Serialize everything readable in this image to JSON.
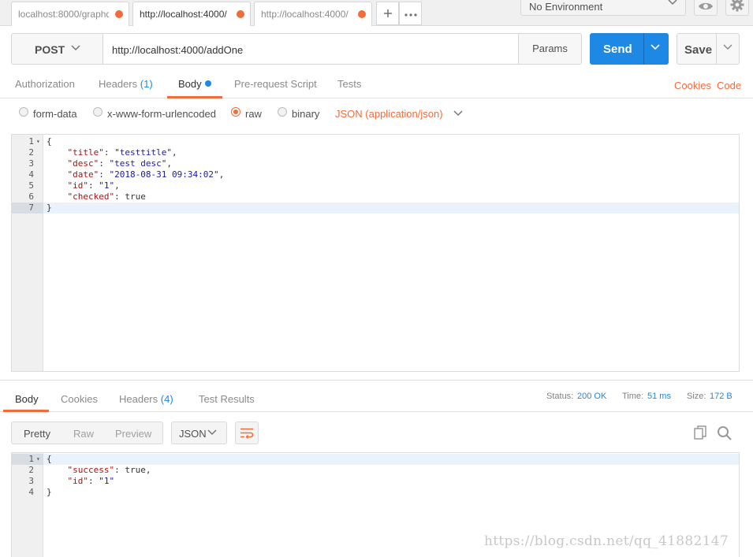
{
  "tabs": [
    {
      "label": "localhost:8000/graphq",
      "active": false
    },
    {
      "label": "http://localhost:4000/",
      "active": true
    },
    {
      "label": "http://localhost:4000/",
      "active": false
    }
  ],
  "tab_actions": {
    "add_icon": "plus-icon",
    "more_icon": "more-icon"
  },
  "environment": {
    "selected": "No Environment",
    "eye_icon": "eye-icon",
    "settings_icon": "gear-icon"
  },
  "request": {
    "method": "POST",
    "url": "http://localhost:4000/addOne",
    "params_label": "Params",
    "send_label": "Send",
    "save_label": "Save"
  },
  "request_tabs": [
    {
      "label": "Authorization"
    },
    {
      "label": "Headers",
      "count": "(1)"
    },
    {
      "label": "Body",
      "active": true
    },
    {
      "label": "Pre-request Script"
    },
    {
      "label": "Tests"
    }
  ],
  "request_links": {
    "cookies": "Cookies",
    "code": "Code"
  },
  "body_types": [
    {
      "label": "form-data",
      "selected": false
    },
    {
      "label": "x-www-form-urlencoded",
      "selected": false
    },
    {
      "label": "raw",
      "selected": true
    },
    {
      "label": "binary",
      "selected": false
    }
  ],
  "raw_type": "JSON (application/json)",
  "request_body": {
    "line_numbers": [
      "1",
      "2",
      "3",
      "4",
      "5",
      "6",
      "7"
    ],
    "open_brace": "{",
    "close_brace": "}",
    "fields": [
      {
        "key": "\"title\"",
        "value": "\"testtitle\"",
        "sep": ","
      },
      {
        "key": "\"desc\"",
        "value": "\"test desc\"",
        "sep": ","
      },
      {
        "key": "\"date\"",
        "value": "\"2018-08-31 09:34:02\"",
        "sep": ","
      },
      {
        "key": "\"id\"",
        "value": "\"1\"",
        "sep": ","
      },
      {
        "key": "\"checked\"",
        "value": "true",
        "sep": ""
      }
    ]
  },
  "response_tabs": [
    {
      "label": "Body",
      "active": true
    },
    {
      "label": "Cookies"
    },
    {
      "label": "Headers",
      "count": "(4)"
    },
    {
      "label": "Test Results"
    }
  ],
  "response_status": {
    "status_label": "Status:",
    "status_value": "200 OK",
    "time_label": "Time:",
    "time_value": "51 ms",
    "size_label": "Size:",
    "size_value": "172 B"
  },
  "response_view": {
    "modes": [
      "Pretty",
      "Raw",
      "Preview"
    ],
    "selected_mode": "Pretty",
    "format": "JSON",
    "wrap_icon": "wrap-lines-icon",
    "copy_icon": "copy-icon",
    "search_icon": "search-icon"
  },
  "response_body": {
    "line_numbers": [
      "1",
      "2",
      "3",
      "4"
    ],
    "open_brace": "{",
    "close_brace": "}",
    "fields": [
      {
        "key": "\"success\"",
        "value": "true",
        "sep": ","
      },
      {
        "key": "\"id\"",
        "value": "\"1\"",
        "sep": ""
      }
    ]
  },
  "watermark": "https://blog.csdn.net/qq_41882147",
  "colors": {
    "accent": "#f26b3a",
    "primary": "#1e88e5"
  }
}
